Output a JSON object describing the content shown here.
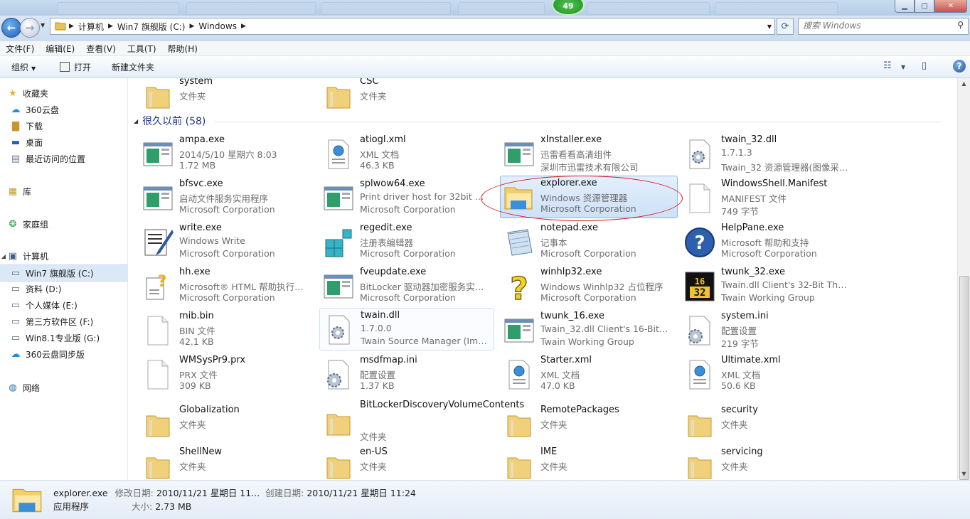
{
  "titlebar": {
    "badge": "49"
  },
  "address": {
    "segments": [
      "计算机",
      "Win7 旗舰版 (C:)",
      "Windows"
    ]
  },
  "search": {
    "placeholder": "搜索 Windows"
  },
  "menu": [
    "文件(F)",
    "编辑(E)",
    "查看(V)",
    "工具(T)",
    "帮助(H)"
  ],
  "toolbar": {
    "organize": "组织",
    "open": "打开",
    "new_folder": "新建文件夹"
  },
  "sidebar": {
    "favorites": "收藏夹",
    "fav_items": [
      "360云盘",
      "下载",
      "桌面",
      "最近访问的位置"
    ],
    "libraries": "库",
    "homegroup": "家庭组",
    "computer": "计算机",
    "drives": [
      "Win7 旗舰版 (C:)",
      "资料 (D:)",
      "个人媒体 (E:)",
      "第三方软件区 (F:)",
      "Win8.1专业版 (G:)",
      "360云盘同步版"
    ],
    "network": "网络"
  },
  "top_items": [
    {
      "name": "system",
      "l1": "文件夹"
    },
    {
      "name": "CSC",
      "l1": "文件夹"
    }
  ],
  "group": {
    "label": "很久以前 (58)"
  },
  "items": [
    {
      "name": "ampa.exe",
      "l1": "2014/5/10 星期六 8:03",
      "l2": "1.72 MB"
    },
    {
      "name": "atiogl.xml",
      "l1": "XML 文档",
      "l2": "46.3 KB"
    },
    {
      "name": "xInstaller.exe",
      "l1": "迅雷看看高清组件",
      "l2": "深圳市迅雷技术有限公司"
    },
    {
      "name": "twain_32.dll",
      "l1": "1.7.1.3",
      "l2": "Twain_32 资源管理器(图像采集..."
    },
    {
      "name": "bfsvc.exe",
      "l1": "启动文件服务实用程序",
      "l2": "Microsoft Corporation"
    },
    {
      "name": "splwow64.exe",
      "l1": "Print driver host for 32bit appl...",
      "l2": "Microsoft Corporation"
    },
    {
      "name": "explorer.exe",
      "l1": "Windows 资源管理器",
      "l2": "Microsoft Corporation"
    },
    {
      "name": "WindowsShell.Manifest",
      "l1": "MANIFEST 文件",
      "l2": "749 字节"
    },
    {
      "name": "write.exe",
      "l1": "Windows Write",
      "l2": "Microsoft Corporation"
    },
    {
      "name": "regedit.exe",
      "l1": "注册表编辑器",
      "l2": "Microsoft Corporation"
    },
    {
      "name": "notepad.exe",
      "l1": "记事本",
      "l2": "Microsoft Corporation"
    },
    {
      "name": "HelpPane.exe",
      "l1": "Microsoft 帮助和支持",
      "l2": "Microsoft Corporation"
    },
    {
      "name": "hh.exe",
      "l1": "Microsoft® HTML 帮助执行程序",
      "l2": "Microsoft Corporation"
    },
    {
      "name": "fveupdate.exe",
      "l1": "BitLocker 驱动器加密服务实用工...",
      "l2": "Microsoft Corporation"
    },
    {
      "name": "winhlp32.exe",
      "l1": "Windows Winhlp32 占位程序",
      "l2": "Microsoft Corporation"
    },
    {
      "name": "twunk_32.exe",
      "l1": "Twain.dll Client's 32-Bit Thunki...",
      "l2": "Twain Working Group"
    },
    {
      "name": "mib.bin",
      "l1": "BIN 文件",
      "l2": "42.1 KB"
    },
    {
      "name": "twain.dll",
      "l1": "1.7.0.0",
      "l2": "Twain Source Manager (Imag..."
    },
    {
      "name": "twunk_16.exe",
      "l1": "Twain_32.dll Client's 16-Bit Thu...",
      "l2": "Twain Working Group"
    },
    {
      "name": "system.ini",
      "l1": "配置设置",
      "l2": "219 字节"
    },
    {
      "name": "WMSysPr9.prx",
      "l1": "PRX 文件",
      "l2": "309 KB"
    },
    {
      "name": "msdfmap.ini",
      "l1": "配置设置",
      "l2": "1.37 KB"
    },
    {
      "name": "Starter.xml",
      "l1": "XML 文档",
      "l2": "47.0 KB"
    },
    {
      "name": "Ultimate.xml",
      "l1": "XML 文档",
      "l2": "50.6 KB"
    },
    {
      "name": "Globalization",
      "l1": "文件夹"
    },
    {
      "name": "BitLockerDiscoveryVolumeContents",
      "l1": "文件夹"
    },
    {
      "name": "RemotePackages",
      "l1": "文件夹"
    },
    {
      "name": "security",
      "l1": "文件夹"
    },
    {
      "name": "ShellNew",
      "l1": "文件夹"
    },
    {
      "name": "en-US",
      "l1": "文件夹"
    },
    {
      "name": "IME",
      "l1": "文件夹"
    },
    {
      "name": "servicing",
      "l1": "文件夹"
    }
  ],
  "status": {
    "name": "explorer.exe",
    "modified_label": "修改日期:",
    "modified": "2010/11/21 星期日 11...",
    "created_label": "创建日期:",
    "created": "2010/11/21 星期日 11:24",
    "type": "应用程序",
    "size_label": "大小:",
    "size": "2.73 MB"
  }
}
